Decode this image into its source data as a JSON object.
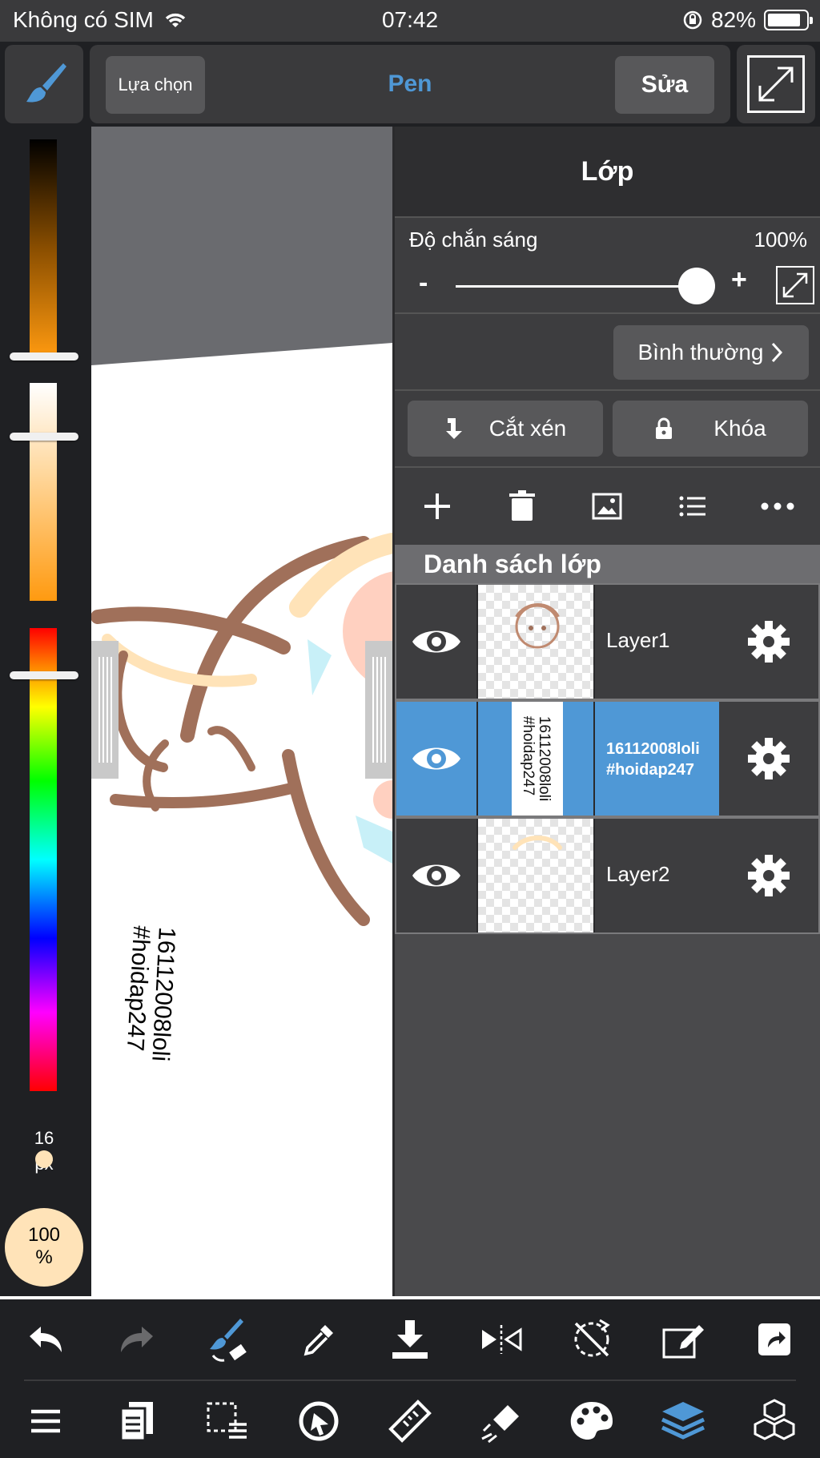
{
  "status_bar": {
    "carrier": "Không có SIM",
    "time": "07:42",
    "battery": "82%"
  },
  "top_bar": {
    "select_label": "Lựa chọn",
    "brush_name": "Pen",
    "edit_label": "Sửa"
  },
  "color_panel": {
    "brush_size": "16",
    "brush_size_unit": "px",
    "opacity_line1": "100",
    "opacity_line2": "%"
  },
  "canvas": {
    "text_line1": "16112008loli",
    "text_line2": "#hoidap247"
  },
  "layer_panel": {
    "title": "Lớp",
    "opacity_label": "Độ chắn sáng",
    "opacity_value": "100%",
    "opacity_level": 1.0,
    "minus": "-",
    "plus": "+",
    "blend_mode": "Bình thường",
    "clip_label": "Cắt xén",
    "lock_label": "Khóa",
    "list_title": "Danh sách lớp",
    "layers": [
      {
        "name": "Layer1",
        "selected": false
      },
      {
        "name_line1": "16112008loli",
        "name_line2": "#hoidap247",
        "selected": true
      },
      {
        "name": "Layer2",
        "selected": false
      }
    ]
  },
  "colors": {
    "accent": "#4f98d6",
    "panel": "#4a4a4c",
    "selected_row": "#4f98d6",
    "skin": "#ffe3b8",
    "stroke_brown": "#a0705a"
  },
  "icons": [
    "brush-icon",
    "expand-icon",
    "wifi-icon",
    "orientation-lock-icon",
    "add-layer-icon",
    "trash-icon",
    "image-icon",
    "list-icon",
    "more-icon",
    "eye-icon",
    "gear-icon",
    "undo-icon",
    "redo-icon",
    "brush-eraser-icon",
    "eyedropper-icon",
    "download-icon",
    "flip-icon",
    "rotate-off-icon",
    "edit-canvas-icon",
    "share-icon",
    "menu-icon",
    "pages-icon",
    "selection-icon",
    "transform-icon",
    "ruler-icon",
    "fill-icon",
    "palette-icon",
    "layers-icon",
    "material-icon"
  ]
}
